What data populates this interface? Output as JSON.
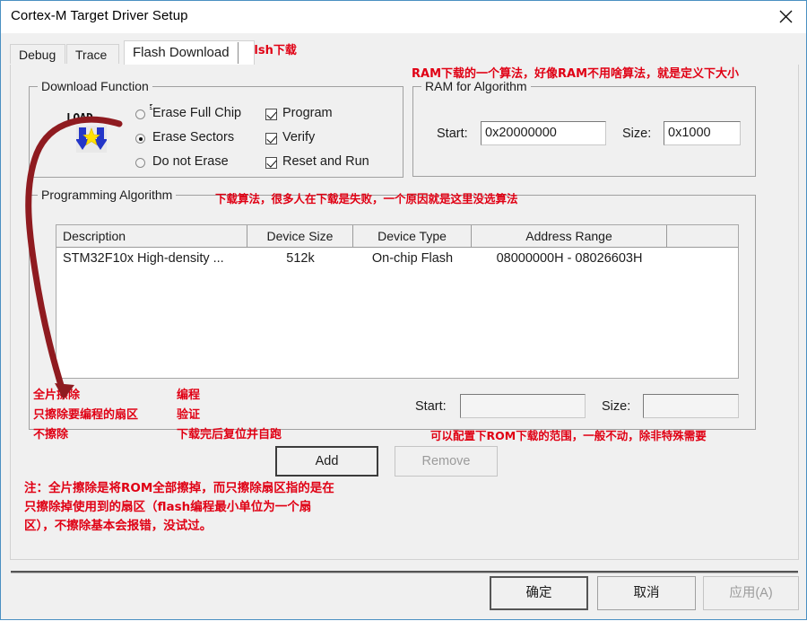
{
  "window": {
    "title": "Cortex-M Target Driver Setup",
    "close_icon": "close-icon"
  },
  "tabs": [
    {
      "label": "Debug",
      "active": false
    },
    {
      "label": "Trace",
      "active": false
    },
    {
      "label": "Flash Download",
      "active": true
    }
  ],
  "download_function": {
    "group_title": "Download Function",
    "icon_word": "LOAD",
    "erase_options": [
      {
        "label": "Erase Full Chip",
        "selected": false,
        "focused": true
      },
      {
        "label": "Erase Sectors",
        "selected": true,
        "focused": false
      },
      {
        "label": "Do not Erase",
        "selected": false,
        "focused": false
      }
    ],
    "checkboxes": [
      {
        "label": "Program",
        "checked": true
      },
      {
        "label": "Verify",
        "checked": true
      },
      {
        "label": "Reset and Run",
        "checked": true
      }
    ]
  },
  "ram_for_algorithm": {
    "group_title": "RAM for Algorithm",
    "start_label": "Start:",
    "start_value": "0x20000000",
    "size_label": "Size:",
    "size_value": "0x1000"
  },
  "programming_algorithm": {
    "group_title": "Programming Algorithm",
    "columns": [
      "Description",
      "Device Size",
      "Device Type",
      "Address Range",
      ""
    ],
    "rows": [
      {
        "description": "STM32F10x High-density ...",
        "device_size": "512k",
        "device_type": "On-chip Flash",
        "address_range": "08000000H - 08026603H"
      }
    ],
    "range_start_label": "Start:",
    "range_start_value": "",
    "range_size_label": "Size:",
    "range_size_value": "",
    "add_label": "Add",
    "remove_label": "Remove"
  },
  "footer": {
    "ok_label": "确定",
    "cancel_label": "取消",
    "apply_label": "应用(A)"
  },
  "annotations": {
    "tab_note": "falsh下载",
    "ram_note": "RAM下载的一个算法，好像RAM不用啥算法，就是定义下大小",
    "algo_note": "下载算法，很多人在下载是失败，一个原因就是这里没选算法",
    "erase_col": "全片擦除\n只擦除要编程的扇区\n不擦除",
    "program_col": "编程\n验证\n下载完后复位并自跑",
    "rom_range_note": "可以配置下ROM下载的范围，一般不动，除非特殊需要",
    "bottom_note": "注：全片擦除是将ROM全部擦掉，而只擦除扇区指的是在\n只擦除掉使用到的扇区（flash编程最小单位为一个扇\n区），不擦除基本会报错，没试过。"
  },
  "colors": {
    "annotation_red": "#e00014",
    "arrow_dark_red": "#8f1b20",
    "window_bg": "#f0f0f0",
    "accent_border": "#4a90c2"
  }
}
